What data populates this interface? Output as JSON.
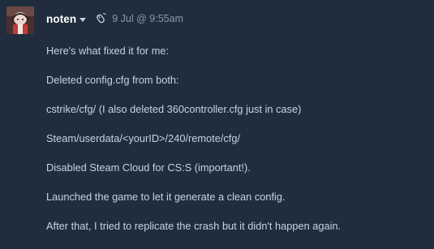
{
  "post": {
    "author": "noten",
    "timestamp": "9 Jul @ 9:55am",
    "lines": [
      "Here's what fixed it for me:",
      "Deleted config.cfg from both:",
      "cstrike/cfg/ (I also deleted 360controller.cfg just in case)",
      "Steam/userdata/<yourID>/240/remote/cfg/",
      "Disabled Steam Cloud for CS:S (important!).",
      "Launched the game to let it generate a clean config.",
      "After that, I tried to replicate the crash but it didn't happen again."
    ]
  },
  "icons": {
    "author_menu": "chevron-down-icon",
    "post_source": "mouse-icon"
  },
  "colors": {
    "background": "#1f2d3e",
    "author": "#ffffff",
    "timestamp": "#8c98a5",
    "body_text": "#c6d4df"
  }
}
